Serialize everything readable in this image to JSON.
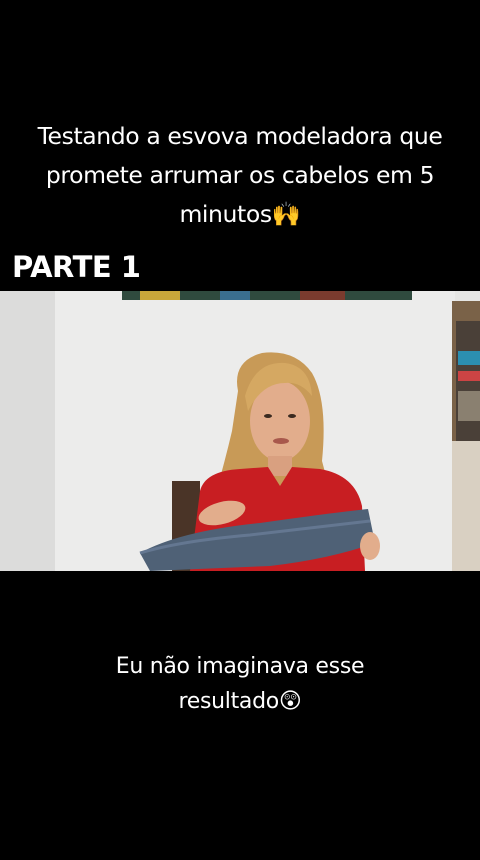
{
  "overlay_caption": {
    "lines": [
      "Testando a esvova modeladora que",
      "promete arrumar os cabelos em 5",
      "minutos🙌"
    ]
  },
  "part_label": "PARTE 1",
  "subtitle": {
    "lines": [
      "Eu não imaginava esse",
      "resultado😲"
    ]
  }
}
